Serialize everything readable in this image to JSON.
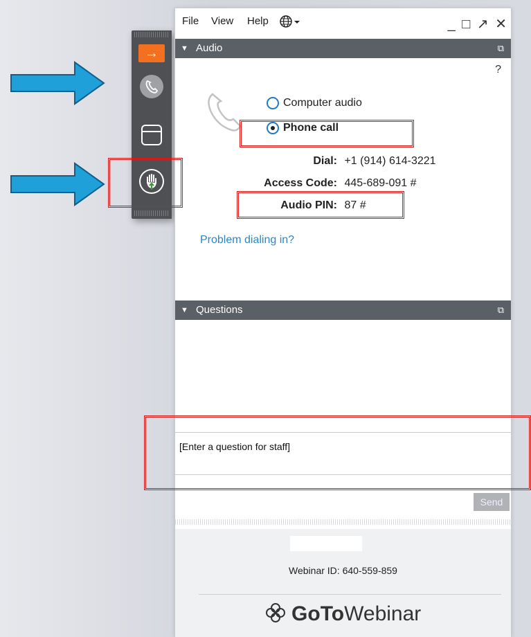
{
  "menu": {
    "file": "File",
    "view": "View",
    "help": "Help"
  },
  "window_controls": "_ □ ↗ ✕",
  "toolbar": {
    "expand": "→"
  },
  "audio": {
    "header": "Audio",
    "help": "?",
    "options": [
      {
        "label": "Computer audio",
        "selected": false
      },
      {
        "label": "Phone call",
        "selected": true
      }
    ],
    "dial_label": "Dial:",
    "dial_value": "+1 (914) 614-3221",
    "access_label": "Access Code:",
    "access_value": "445-689-091 #",
    "pin_label": "Audio PIN:",
    "pin_value": "87 #",
    "problem_link": "Problem dialing in?"
  },
  "questions": {
    "header": "Questions",
    "placeholder": "[Enter a question for staff]",
    "send": "Send"
  },
  "footer": {
    "webinar_id": "Webinar ID: 640-559-859",
    "logo_goto": "GoTo",
    "logo_webinar": "Webinar"
  },
  "colors": {
    "header_bg": "#5b5f66",
    "toolbar_bg": "#4e5054",
    "accent_orange": "#f37021",
    "link_blue": "#2b86c5",
    "annotation_red": "#d41c1c",
    "arrow_blue": "#1fa0d8"
  }
}
